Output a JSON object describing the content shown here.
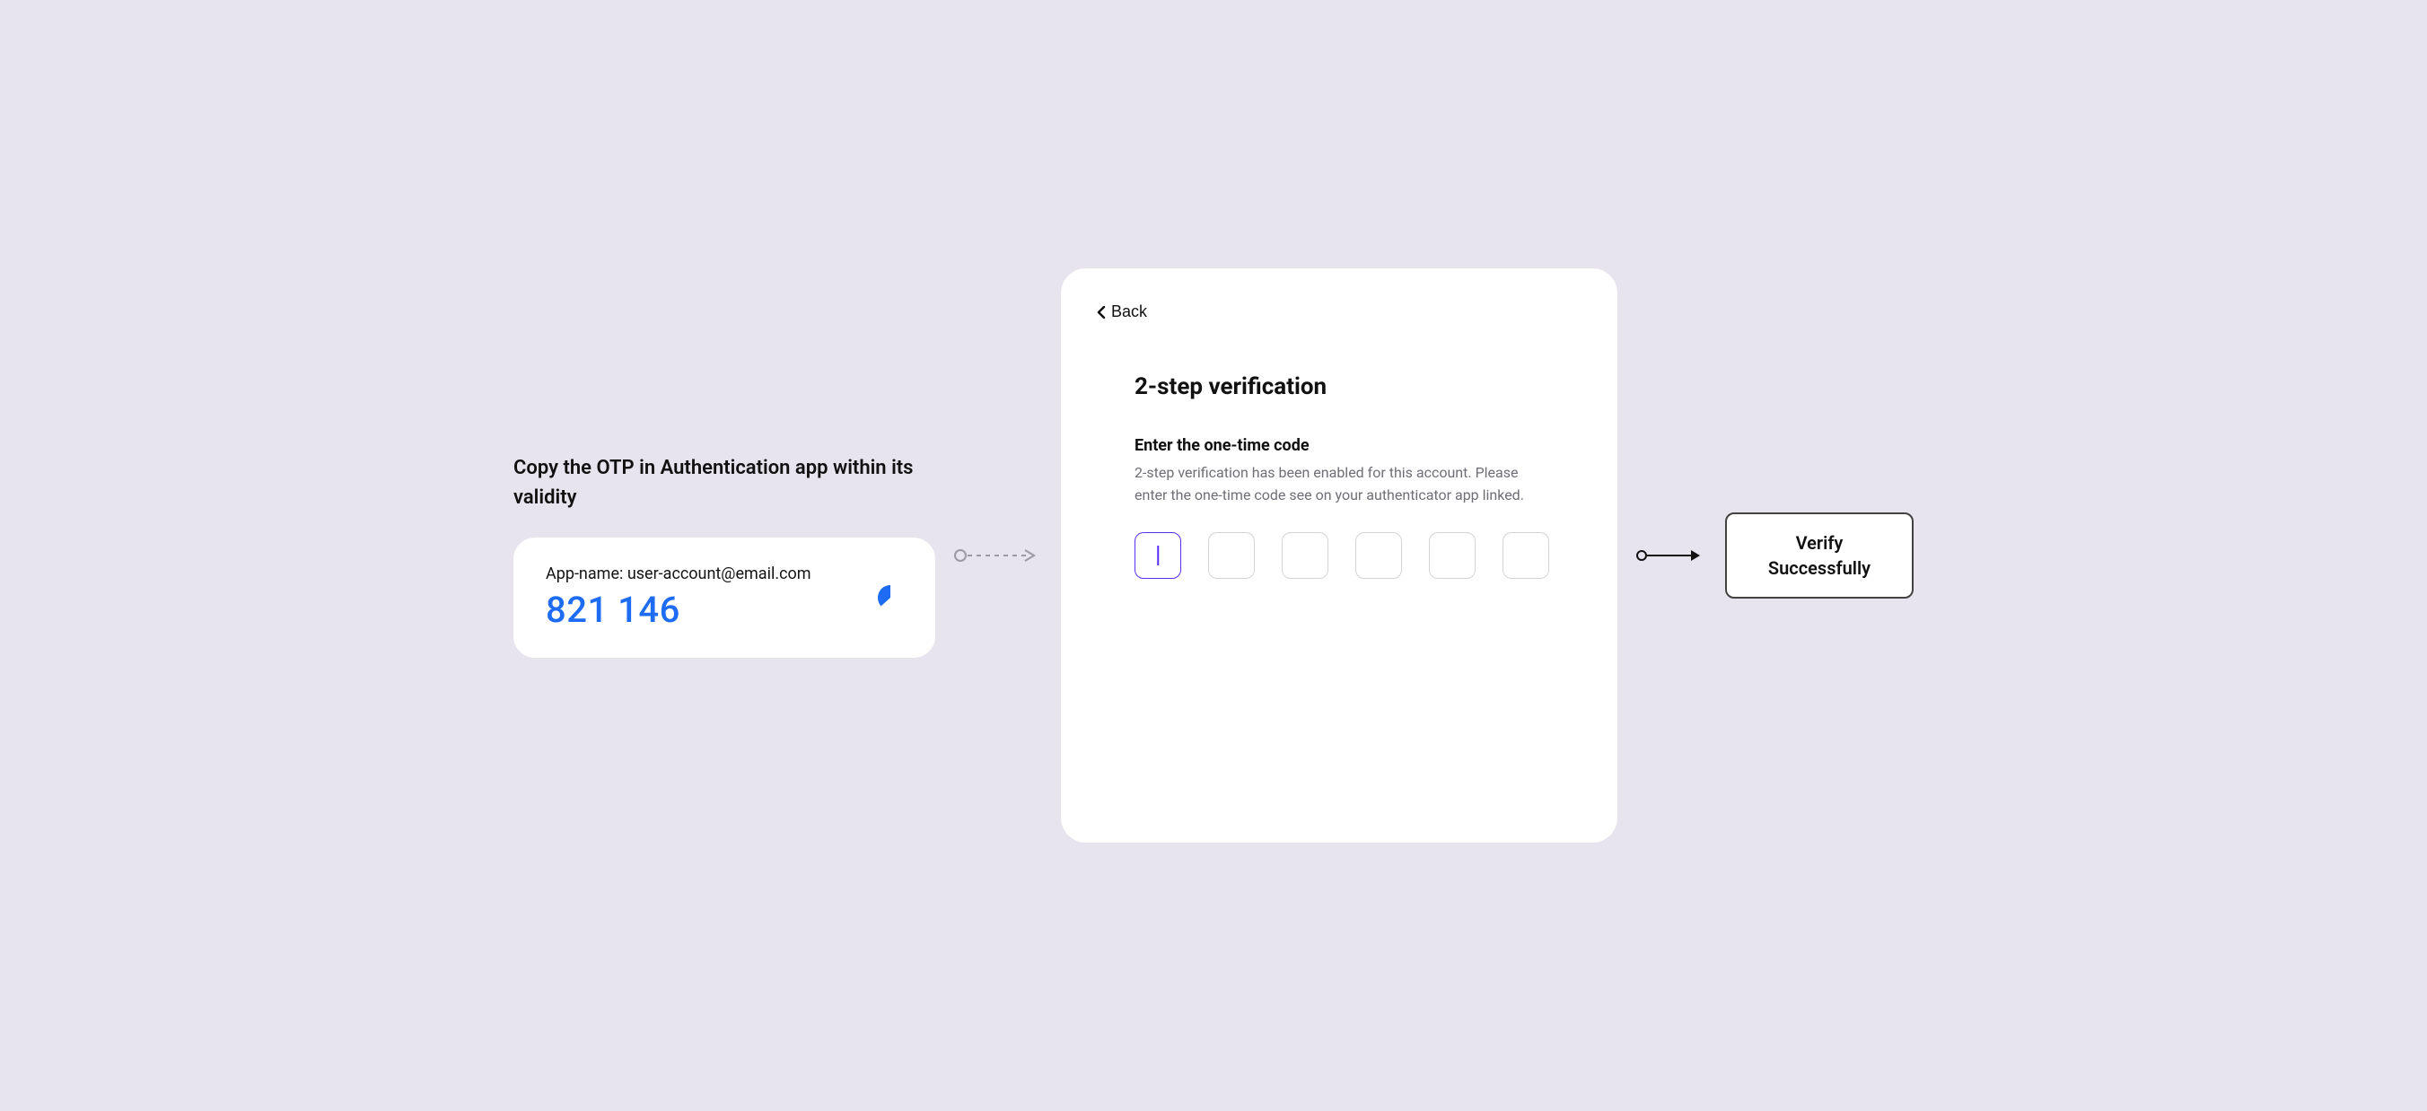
{
  "left": {
    "instruction": "Copy the OTP in Authentication app within its validity",
    "account_line": "App-name: user-account@email.com",
    "otp_code": "821 146"
  },
  "panel": {
    "back_label": "Back",
    "title": "2-step verification",
    "subheading": "Enter the one-time code",
    "description": "2-step verification has been enabled for this account. Please enter the one-time code see on your authenticator app linked.",
    "digits": [
      "",
      "",
      "",
      "",
      "",
      ""
    ],
    "active_index": 0
  },
  "result": {
    "line1": "Verify",
    "line2": "Successfully"
  },
  "colors": {
    "accent_blue": "#1E6CF4",
    "focus_purple": "#5B2FF5",
    "bg": "#E7E4EE"
  }
}
